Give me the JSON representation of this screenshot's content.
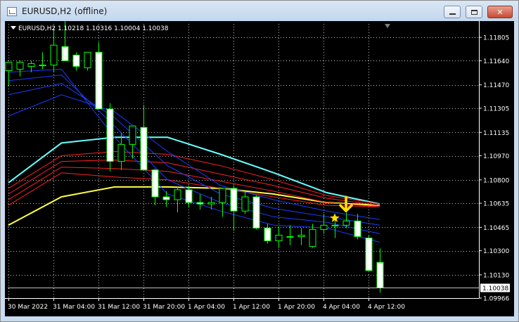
{
  "window": {
    "title": "EURUSD,H2 (offline)",
    "minimize_icon": "minimize-icon",
    "maximize_icon": "maximize-icon",
    "close_icon": "close-icon",
    "close_glyph": "✕"
  },
  "chart": {
    "symbol_line": "EURUSD,H2  1.10218 1.10316 1.10004 1.10038",
    "current_price_label": "1.10038",
    "colors": {
      "background": "#000000",
      "grid": "#c0c0c0",
      "bull_candle": "#000000",
      "bear_candle": "#ffffff",
      "wick": "#00ff00",
      "ma_cyan": "#66ffff",
      "ma_yellow": "#ffff44",
      "ma_red": "#ff2020",
      "ma_blue": "#1a3cff",
      "signal": "#ffdd00"
    }
  },
  "chart_data": {
    "type": "candlestick",
    "symbol": "EURUSD",
    "timeframe": "H2",
    "y_ticks": [
      "1.11805",
      "1.11640",
      "1.11470",
      "1.11305",
      "1.11135",
      "1.10970",
      "1.10800",
      "1.10635",
      "1.10465",
      "1.10300",
      "1.10130",
      "1.09966"
    ],
    "ylim": [
      1.09966,
      1.119
    ],
    "x_ticks": [
      "30 Mar 2022",
      "31 Mar 04:00",
      "31 Mar 12:00",
      "31 Mar 20:00",
      "1 Apr 04:00",
      "1 Apr 12:00",
      "1 Apr 20:00",
      "4 Apr 04:00",
      "4 Apr 12:00"
    ],
    "last_price": 1.10038,
    "candles": [
      {
        "o": 1.1157,
        "h": 1.1163,
        "l": 1.1146,
        "c": 1.1163
      },
      {
        "o": 1.1158,
        "h": 1.1164,
        "l": 1.1153,
        "c": 1.1163
      },
      {
        "o": 1.116,
        "h": 1.1164,
        "l": 1.1156,
        "c": 1.1162
      },
      {
        "o": 1.1161,
        "h": 1.117,
        "l": 1.1158,
        "c": 1.1161
      },
      {
        "o": 1.1161,
        "h": 1.1187,
        "l": 1.1156,
        "c": 1.1175
      },
      {
        "o": 1.1174,
        "h": 1.1192,
        "l": 1.1164,
        "c": 1.1164
      },
      {
        "o": 1.1168,
        "h": 1.117,
        "l": 1.1157,
        "c": 1.116
      },
      {
        "o": 1.1159,
        "h": 1.117,
        "l": 1.1157,
        "c": 1.117
      },
      {
        "o": 1.117,
        "h": 1.1177,
        "l": 1.113,
        "c": 1.113
      },
      {
        "o": 1.113,
        "h": 1.1134,
        "l": 1.1086,
        "c": 1.1093
      },
      {
        "o": 1.1093,
        "h": 1.1113,
        "l": 1.1087,
        "c": 1.1105
      },
      {
        "o": 1.1105,
        "h": 1.1118,
        "l": 1.1095,
        "c": 1.1118
      },
      {
        "o": 1.1117,
        "h": 1.1133,
        "l": 1.1092,
        "c": 1.1087
      },
      {
        "o": 1.1087,
        "h": 1.1088,
        "l": 1.1062,
        "c": 1.1068
      },
      {
        "o": 1.1068,
        "h": 1.1072,
        "l": 1.1061,
        "c": 1.1066
      },
      {
        "o": 1.1066,
        "h": 1.1075,
        "l": 1.1057,
        "c": 1.1073
      },
      {
        "o": 1.1073,
        "h": 1.1076,
        "l": 1.1061,
        "c": 1.1064
      },
      {
        "o": 1.1064,
        "h": 1.107,
        "l": 1.1059,
        "c": 1.1063
      },
      {
        "o": 1.1063,
        "h": 1.1068,
        "l": 1.1059,
        "c": 1.1064
      },
      {
        "o": 1.1064,
        "h": 1.1074,
        "l": 1.1054,
        "c": 1.1074
      },
      {
        "o": 1.1074,
        "h": 1.1076,
        "l": 1.1044,
        "c": 1.1058
      },
      {
        "o": 1.1058,
        "h": 1.1072,
        "l": 1.1056,
        "c": 1.1068
      },
      {
        "o": 1.1068,
        "h": 1.1069,
        "l": 1.1045,
        "c": 1.1046
      },
      {
        "o": 1.1046,
        "h": 1.1049,
        "l": 1.1035,
        "c": 1.1037
      },
      {
        "o": 1.1037,
        "h": 1.1047,
        "l": 1.1032,
        "c": 1.1041
      },
      {
        "o": 1.104,
        "h": 1.1048,
        "l": 1.1034,
        "c": 1.104
      },
      {
        "o": 1.104,
        "h": 1.1046,
        "l": 1.1034,
        "c": 1.1041
      },
      {
        "o": 1.1033,
        "h": 1.1049,
        "l": 1.1032,
        "c": 1.1045
      },
      {
        "o": 1.1045,
        "h": 1.1056,
        "l": 1.1042,
        "c": 1.1048
      },
      {
        "o": 1.1048,
        "h": 1.1054,
        "l": 1.1039,
        "c": 1.1048
      },
      {
        "o": 1.1048,
        "h": 1.1057,
        "l": 1.1046,
        "c": 1.1051
      },
      {
        "o": 1.1051,
        "h": 1.1056,
        "l": 1.1038,
        "c": 1.104
      },
      {
        "o": 1.1039,
        "h": 1.1041,
        "l": 1.1016,
        "c": 1.1016
      },
      {
        "o": 1.10218,
        "h": 1.10316,
        "l": 1.10004,
        "c": 1.10038
      }
    ],
    "moving_averages": [
      {
        "color": "#66ffff",
        "values": [
          1.1078,
          1.1106,
          1.111,
          1.111,
          1.1098,
          1.1085,
          1.1071,
          1.1063
        ]
      },
      {
        "color": "#ffff44",
        "values": [
          1.1048,
          1.1068,
          1.1075,
          1.1075,
          1.1074,
          1.107,
          1.1064,
          1.1062
        ]
      },
      {
        "color": "#ff2020",
        "values": [
          1.1074,
          1.1097,
          1.11,
          1.1098,
          1.109,
          1.108,
          1.1069,
          1.1063
        ]
      },
      {
        "color": "#ff2020",
        "values": [
          1.107,
          1.1093,
          1.1094,
          1.1092,
          1.1084,
          1.1076,
          1.1067,
          1.1062
        ]
      },
      {
        "color": "#ff2020",
        "values": [
          1.1066,
          1.1089,
          1.1088,
          1.1086,
          1.1079,
          1.1072,
          1.1064,
          1.1061
        ]
      },
      {
        "color": "#ff2020",
        "values": [
          1.1062,
          1.1085,
          1.1082,
          1.108,
          1.1074,
          1.1068,
          1.1062,
          1.1061
        ]
      },
      {
        "color": "#1a3cff",
        "values": [
          1.1156,
          1.1158,
          1.111,
          1.107,
          1.1058,
          1.1048,
          1.1046,
          1.1036
        ]
      },
      {
        "color": "#1a3cff",
        "values": [
          1.115,
          1.1154,
          1.1118,
          1.108,
          1.1064,
          1.1054,
          1.105,
          1.1042
        ]
      },
      {
        "color": "#1a3cff",
        "values": [
          1.114,
          1.1148,
          1.1124,
          1.109,
          1.107,
          1.106,
          1.1054,
          1.1048
        ]
      },
      {
        "color": "#1a3cff",
        "values": [
          1.1125,
          1.114,
          1.1128,
          1.11,
          1.1076,
          1.1066,
          1.1058,
          1.1052
        ]
      }
    ],
    "signals": [
      {
        "type": "star",
        "candle_index": 29,
        "price": 1.1053
      },
      {
        "type": "arrow-down",
        "candle_index": 30,
        "price": 1.1063
      }
    ]
  }
}
